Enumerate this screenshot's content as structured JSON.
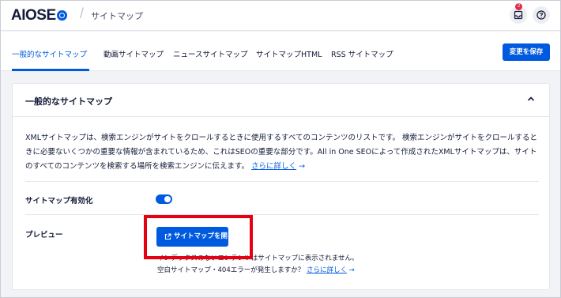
{
  "header": {
    "logo_main": "AIOSE",
    "breadcrumb_sep": "/",
    "breadcrumb": "サイトマップ",
    "notification_count": "2",
    "colors": {
      "accent": "#005ae0",
      "badge": "#df2a4a",
      "highlight": "#e60012"
    }
  },
  "tabs": [
    {
      "label": "一般的なサイトマップ",
      "active": true
    },
    {
      "label": "動画サイトマップ"
    },
    {
      "label": "ニュースサイトマップ"
    },
    {
      "label": "サイトマップHTML"
    },
    {
      "label": "RSS サイトマップ"
    }
  ],
  "save_label": "変更を保存",
  "card": {
    "title": "一般的なサイトマップ",
    "description": "XMLサイトマップは、検索エンジンがサイトをクロールするときに使用するすべてのコンテンツのリストです。 検索エンジンがサイトをクロールするときに必要ないくつかの重要な情報が含まれているため、これはSEOの重要な部分です。All in One SEOによって作成されたXMLサイトマップは、サイトのすべてのコンテンツを検索する場所を検索エンジンに伝えます。",
    "learn_more": "さらに詳しく",
    "arrow": "→",
    "enable_label": "サイトマップ有効化",
    "enable_on": true,
    "preview_label": "プレビュー",
    "open_button": "サイトマップを開く",
    "note1": "インデックスのないコンテンツはサイトマップに表示されません。",
    "note2": "空白サイトマップ・404エラーが発生しますか？",
    "note2_link": "さらに詳しく"
  }
}
